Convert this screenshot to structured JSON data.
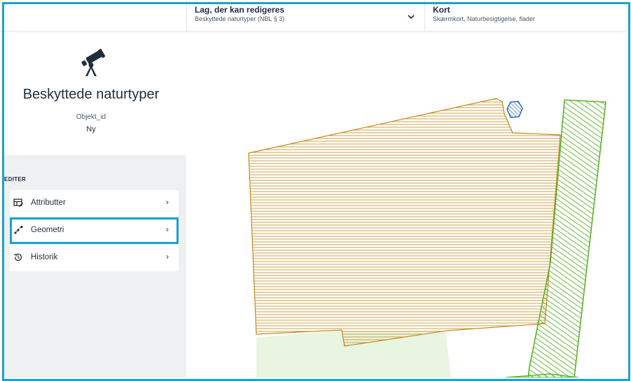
{
  "topbar": {
    "layer": {
      "title": "Lag, der kan redigeres",
      "subtitle": "Beskyttede naturtyper (NBL § 3)"
    },
    "map": {
      "title": "Kort",
      "subtitle": "Skærmkort, Naturbesigtigelse, flader"
    }
  },
  "panel": {
    "icon": "telescope-icon",
    "title": "Beskyttede naturtyper",
    "object_id_label": "Objekt_id",
    "object_id_value": "Ny",
    "section_label": "EDITER",
    "items": [
      {
        "label": "Attributter",
        "icon": "table-edit-icon",
        "active": false
      },
      {
        "label": "Geometri",
        "icon": "geometry-icon",
        "active": true
      },
      {
        "label": "Historik",
        "icon": "history-icon",
        "active": false
      }
    ]
  },
  "colors": {
    "accent": "#1aa3c8",
    "orange_polygon": "#c4871a",
    "green_polygon": "#5bb22a",
    "blue_polygon": "#2a66c8",
    "light_green_area": "#e8f5e0",
    "panel_gray": "#eef0f2"
  }
}
